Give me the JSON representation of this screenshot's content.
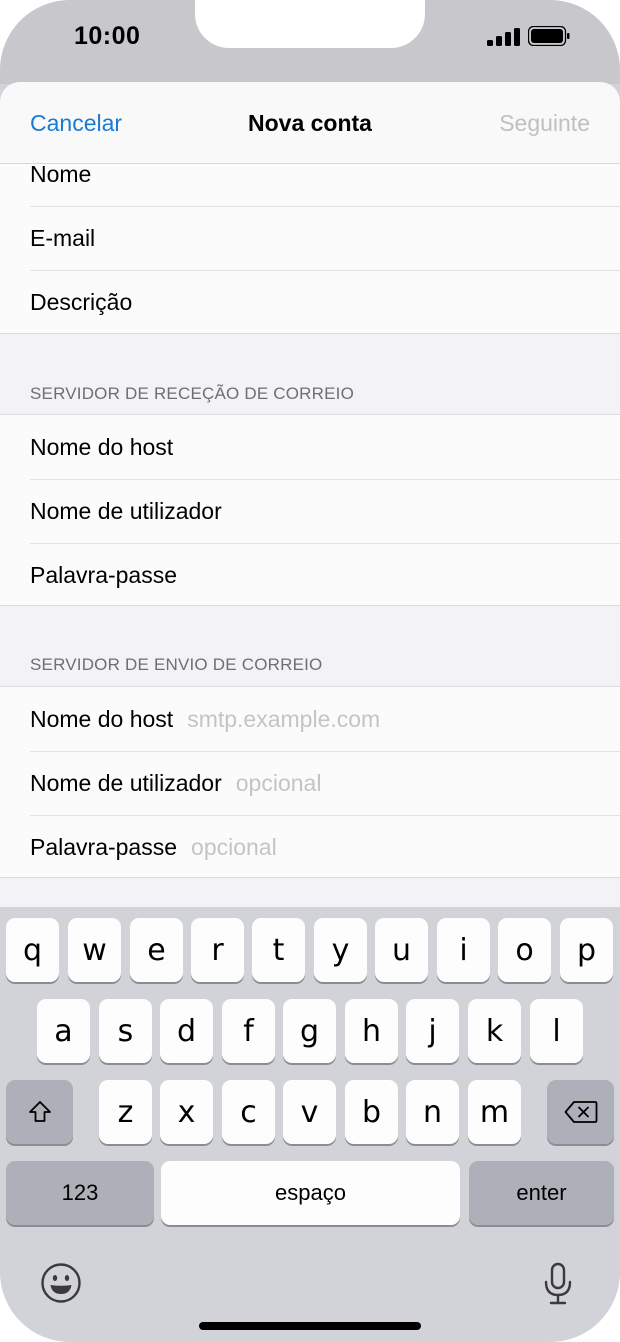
{
  "status": {
    "time": "10:00"
  },
  "nav": {
    "cancel": "Cancelar",
    "title": "Nova conta",
    "next": "Seguinte"
  },
  "account": {
    "name": "Nome",
    "email": "E-mail",
    "description": "Descrição"
  },
  "incoming": {
    "header": "SERVIDOR DE RECEÇÃO DE CORREIO",
    "hostname": "Nome do host",
    "username": "Nome de utilizador",
    "password": "Palavra-passe"
  },
  "outgoing": {
    "header": "SERVIDOR DE ENVIO DE CORREIO",
    "hostname": "Nome do host",
    "hostname_placeholder": "smtp.example.com",
    "username": "Nome de utilizador",
    "username_placeholder": "opcional",
    "password": "Palavra-passe",
    "password_placeholder": "opcional"
  },
  "keyboard": {
    "row1": [
      "q",
      "w",
      "e",
      "r",
      "t",
      "y",
      "u",
      "i",
      "o",
      "p"
    ],
    "row2": [
      "a",
      "s",
      "d",
      "f",
      "g",
      "h",
      "j",
      "k",
      "l"
    ],
    "row3": [
      "z",
      "x",
      "c",
      "v",
      "b",
      "n",
      "m"
    ],
    "numbers": "123",
    "space": "espaço",
    "enter": "enter"
  },
  "colors": {
    "accent": "#1a7bd6",
    "disabled": "#c0c0c4",
    "placeholder": "#c4c4c8"
  }
}
